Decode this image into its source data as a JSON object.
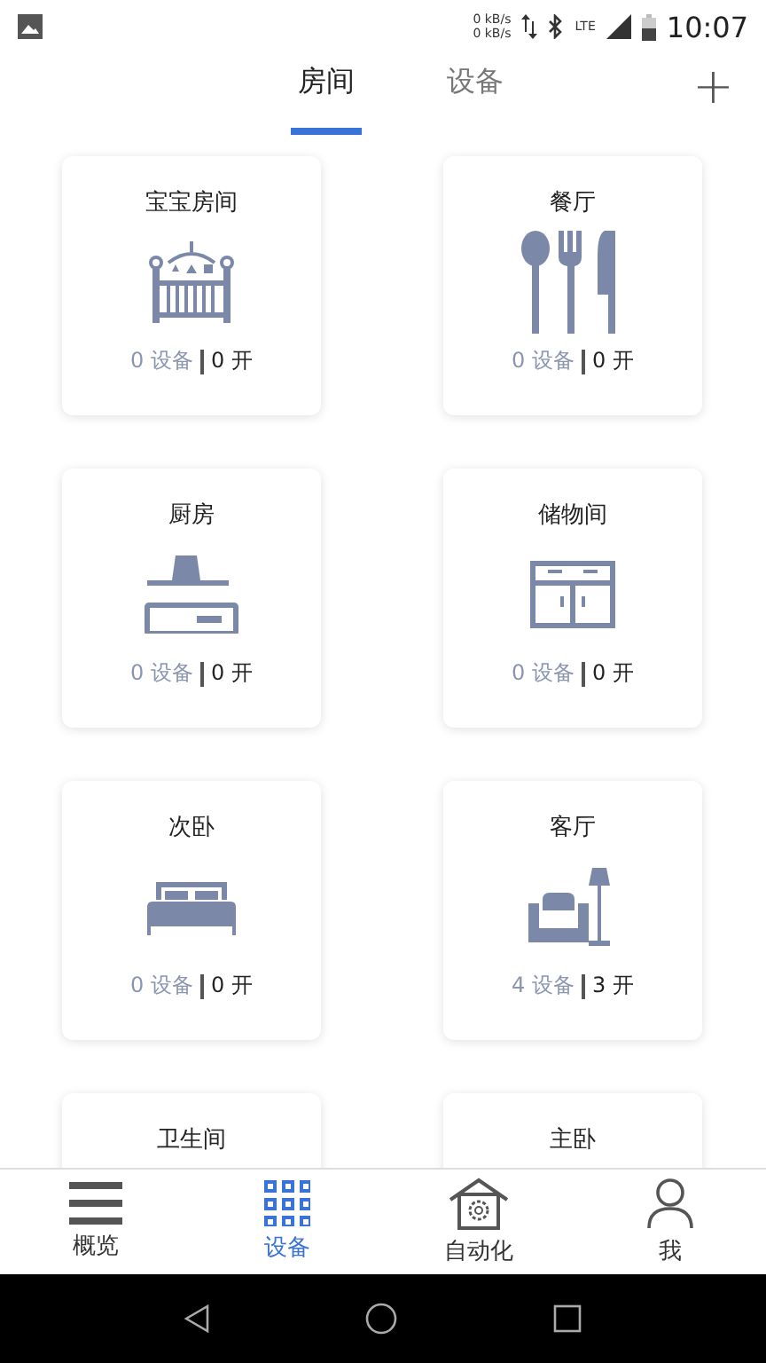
{
  "status_bar": {
    "speed_up": "0 kB/s",
    "speed_down": "0 kB/s",
    "network": "LTE",
    "time": "10:07"
  },
  "tabs": [
    {
      "label": "房间",
      "selected": true
    },
    {
      "label": "设备",
      "selected": false
    }
  ],
  "add_button": {
    "label": "+"
  },
  "rooms": [
    {
      "name": "宝宝房间",
      "kind": "nursery",
      "devices": "0 设备",
      "on": "0 开"
    },
    {
      "name": "餐厅",
      "kind": "dining",
      "devices": "0 设备",
      "on": "0 开"
    },
    {
      "name": "厨房",
      "kind": "kitchen",
      "devices": "0 设备",
      "on": "0 开"
    },
    {
      "name": "储物间",
      "kind": "storage",
      "devices": "0 设备",
      "on": "0 开"
    },
    {
      "name": "次卧",
      "kind": "bedroom",
      "devices": "0 设备",
      "on": "0 开"
    },
    {
      "name": "客厅",
      "kind": "living",
      "devices": "4 设备",
      "on": "3 开"
    },
    {
      "name": "卫生间"
    },
    {
      "name": "主卧"
    }
  ],
  "bottom_nav": [
    {
      "label": "概览",
      "kind": "overview",
      "selected": false
    },
    {
      "label": "设备",
      "kind": "devices",
      "selected": true
    },
    {
      "label": "自动化",
      "kind": "automation",
      "selected": false
    },
    {
      "label": "我",
      "kind": "me",
      "selected": false
    }
  ]
}
